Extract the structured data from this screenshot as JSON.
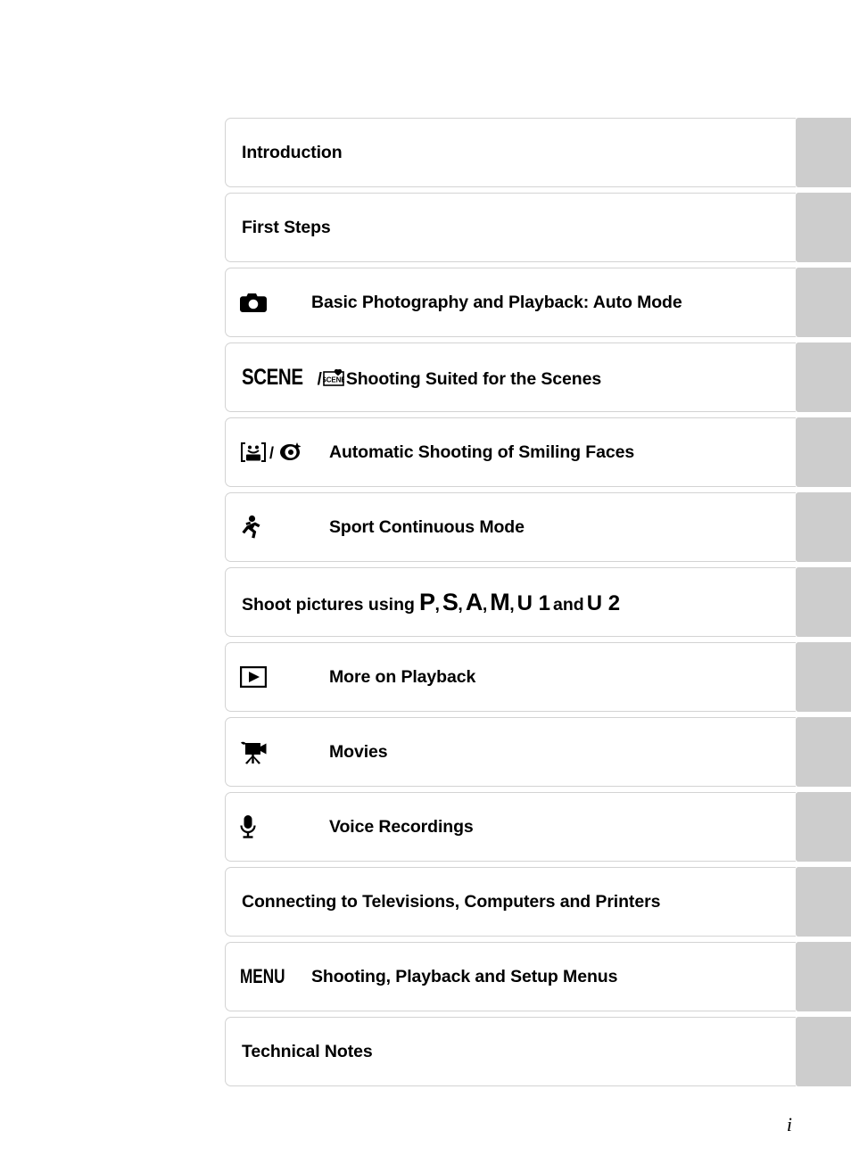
{
  "page": {
    "number": "i",
    "accent_gray": "#cdcdcd",
    "border_gray": "#d3d3d3",
    "text_color": "#000000"
  },
  "toc": {
    "rows": [
      {
        "icon": "none",
        "label": "Introduction"
      },
      {
        "icon": "none",
        "label": "First Steps"
      },
      {
        "icon": "camera-icon",
        "label": "Basic Photography and Playback: Auto Mode"
      },
      {
        "icon": "scene-icon",
        "label": "Shooting Suited for the Scenes",
        "icon_text": "SCENE",
        "icon_badge_text": "SCENE"
      },
      {
        "icon": "smile-face-icon",
        "label": "Automatic Shooting of Smiling Faces"
      },
      {
        "icon": "runner-icon",
        "label": "Sport Continuous Mode"
      },
      {
        "icon": "mode-letters",
        "label": "Shoot pictures using",
        "prefix": "Shoot pictures using",
        "modes": [
          "P",
          "S",
          "A",
          "M"
        ],
        "user_modes": [
          "U 1",
          "U 2"
        ],
        "conjunction": "and"
      },
      {
        "icon": "playback-icon",
        "label": "More on Playback"
      },
      {
        "icon": "movie-icon",
        "label": "Movies"
      },
      {
        "icon": "microphone-icon",
        "label": "Voice Recordings"
      },
      {
        "icon": "none",
        "label": "Connecting to Televisions, Computers and Printers"
      },
      {
        "icon": "menu-icon",
        "label": "Shooting, Playback and Setup Menus",
        "icon_text": "MENU"
      },
      {
        "icon": "none",
        "label": "Technical Notes"
      }
    ]
  }
}
